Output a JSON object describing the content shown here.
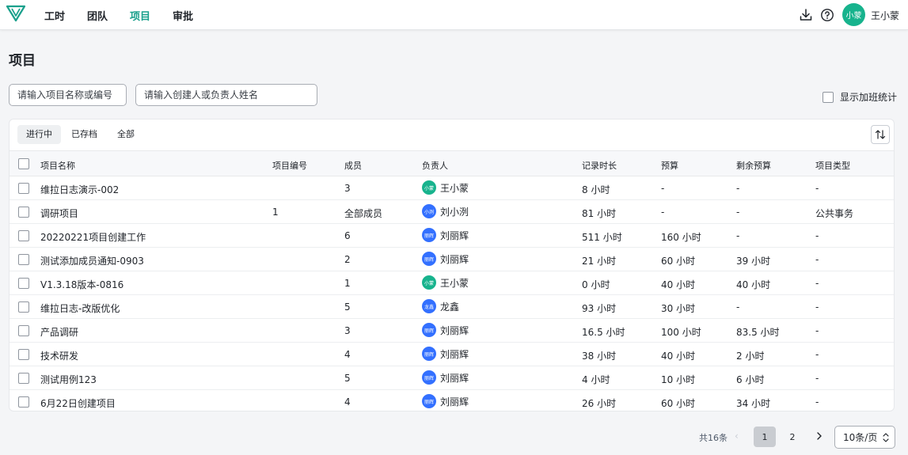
{
  "nav": {
    "items": [
      "工时",
      "团队",
      "项目",
      "审批"
    ],
    "active": "项目"
  },
  "user": {
    "avatar_text": "小蒙",
    "name": "王小蒙"
  },
  "page_title": "项目",
  "filters": {
    "project_placeholder": "请输入项目名称或编号",
    "person_placeholder": "请输入创建人或负责人姓名",
    "overtime_label": "显示加班统计"
  },
  "tabs": [
    "进行中",
    "已存档",
    "全部"
  ],
  "table": {
    "headers": [
      "项目名称",
      "项目编号",
      "成员",
      "负责人",
      "记录时长",
      "预算",
      "剩余预算",
      "项目类型"
    ],
    "rows": [
      {
        "name": "维拉日志演示-002",
        "code": "",
        "members": "3",
        "owner": "王小蒙",
        "owner_avatar": "小蒙",
        "owner_color": "#17b38d",
        "hours": "8 小时",
        "budget": "-",
        "remaining": "-",
        "type": "-"
      },
      {
        "name": "调研项目",
        "code": "1",
        "members": "全部成员",
        "owner": "刘小洌",
        "owner_avatar": "小洌",
        "owner_color": "#3370ff",
        "hours": "81 小时",
        "budget": "-",
        "remaining": "-",
        "type": "公共事务"
      },
      {
        "name": "20220221项目创建工作",
        "code": "",
        "members": "6",
        "owner": "刘丽辉",
        "owner_avatar": "丽辉",
        "owner_color": "#3370ff",
        "hours": "511 小时",
        "budget": "160 小时",
        "remaining": "-",
        "type": "-"
      },
      {
        "name": "测试添加成员通知-0903",
        "code": "",
        "members": "2",
        "owner": "刘丽辉",
        "owner_avatar": "丽辉",
        "owner_color": "#3370ff",
        "hours": "21 小时",
        "budget": "60 小时",
        "remaining": "39 小时",
        "type": "-"
      },
      {
        "name": "V1.3.18版本-0816",
        "code": "",
        "members": "1",
        "owner": "王小蒙",
        "owner_avatar": "小蒙",
        "owner_color": "#17b38d",
        "hours": "0 小时",
        "budget": "40 小时",
        "remaining": "40 小时",
        "type": "-"
      },
      {
        "name": "维拉日志-改版优化",
        "code": "",
        "members": "5",
        "owner": "龙鑫",
        "owner_avatar": "龙鑫",
        "owner_color": "#3370ff",
        "hours": "93 小时",
        "budget": "30 小时",
        "remaining": "-",
        "type": "-"
      },
      {
        "name": "产品调研",
        "code": "",
        "members": "3",
        "owner": "刘丽辉",
        "owner_avatar": "丽辉",
        "owner_color": "#3370ff",
        "hours": "16.5 小时",
        "budget": "100 小时",
        "remaining": "83.5 小时",
        "type": "-"
      },
      {
        "name": "技术研发",
        "code": "",
        "members": "4",
        "owner": "刘丽辉",
        "owner_avatar": "丽辉",
        "owner_color": "#3370ff",
        "hours": "38 小时",
        "budget": "40 小时",
        "remaining": "2 小时",
        "type": "-"
      },
      {
        "name": "测试用例123",
        "code": "",
        "members": "5",
        "owner": "刘丽辉",
        "owner_avatar": "丽辉",
        "owner_color": "#3370ff",
        "hours": "4 小时",
        "budget": "10 小时",
        "remaining": "6 小时",
        "type": "-"
      },
      {
        "name": "6月22日创建项目",
        "code": "",
        "members": "4",
        "owner": "刘丽辉",
        "owner_avatar": "丽辉",
        "owner_color": "#3370ff",
        "hours": "26 小时",
        "budget": "60 小时",
        "remaining": "34 小时",
        "type": "-"
      }
    ]
  },
  "pagination": {
    "total": "共16条",
    "pages": [
      "1",
      "2"
    ],
    "current": "1",
    "page_size": "10条/页"
  },
  "colors": {
    "accent": "#1aa08c",
    "avatar_green": "#17b38d",
    "avatar_blue": "#3370ff"
  }
}
